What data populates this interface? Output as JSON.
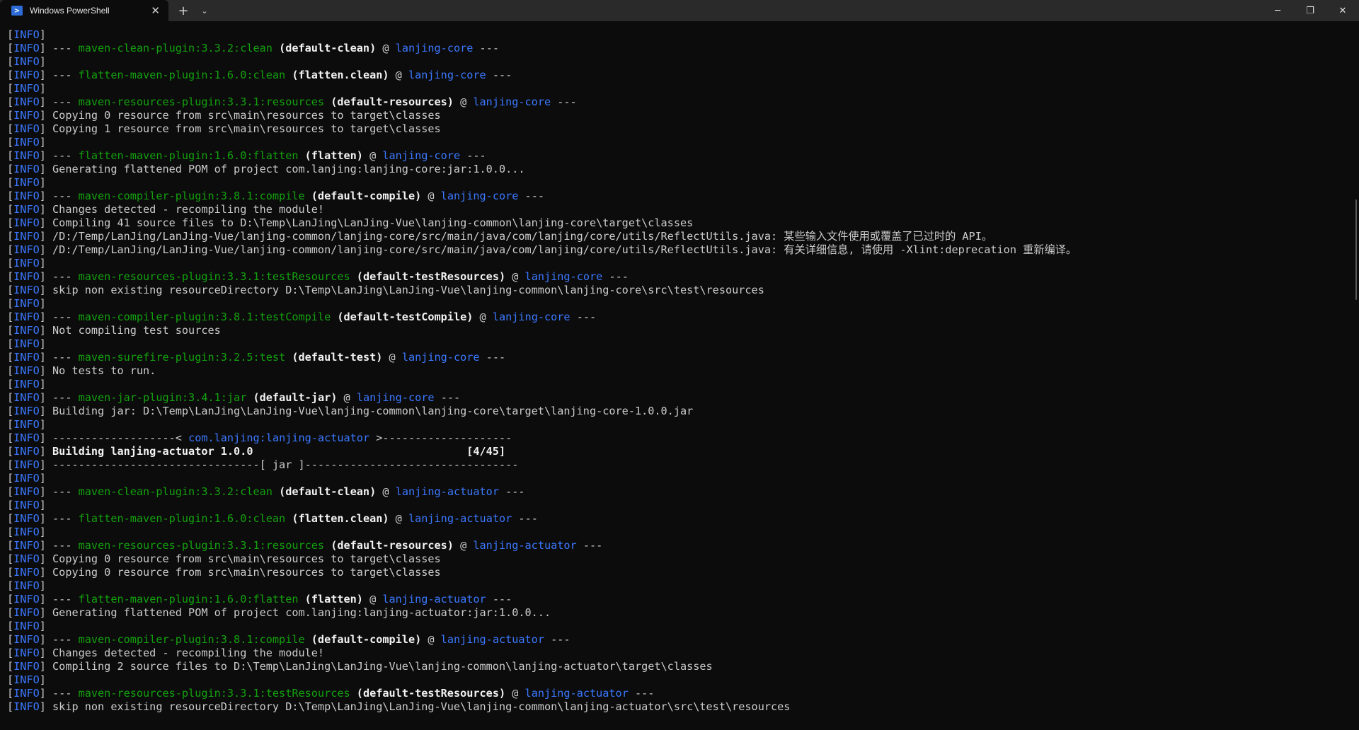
{
  "window": {
    "tab_title": "Windows PowerShell",
    "tab_icon": "powershell-icon",
    "close_glyph": "✕",
    "new_tab_glyph": "+",
    "dropdown_glyph": "⌄",
    "minimize_glyph": "─",
    "restore_glyph": "❐",
    "window_close_glyph": "✕"
  },
  "colors": {
    "background": "#0c0c0c",
    "info": "#3b78ff",
    "plugin": "#13a10e",
    "project": "#3b78ff",
    "text": "#cccccc"
  },
  "terminal": {
    "lines": [
      {
        "type": "blank",
        "level": "INFO"
      },
      {
        "type": "plugin",
        "level": "INFO",
        "prefix": "--- ",
        "plugin": "maven-clean-plugin:3.3.2:clean",
        "exec": " (default-clean)",
        "at": " @ ",
        "project": "lanjing-core",
        "suffix": " ---"
      },
      {
        "type": "blank",
        "level": "INFO"
      },
      {
        "type": "plugin",
        "level": "INFO",
        "prefix": "--- ",
        "plugin": "flatten-maven-plugin:1.6.0:clean",
        "exec": " (flatten.clean)",
        "at": " @ ",
        "project": "lanjing-core",
        "suffix": " ---"
      },
      {
        "type": "blank",
        "level": "INFO"
      },
      {
        "type": "plugin",
        "level": "INFO",
        "prefix": "--- ",
        "plugin": "maven-resources-plugin:3.3.1:resources",
        "exec": " (default-resources)",
        "at": " @ ",
        "project": "lanjing-core",
        "suffix": " ---"
      },
      {
        "type": "text",
        "level": "INFO",
        "text": "Copying 0 resource from src\\main\\resources to target\\classes"
      },
      {
        "type": "text",
        "level": "INFO",
        "text": "Copying 1 resource from src\\main\\resources to target\\classes"
      },
      {
        "type": "blank",
        "level": "INFO"
      },
      {
        "type": "plugin",
        "level": "INFO",
        "prefix": "--- ",
        "plugin": "flatten-maven-plugin:1.6.0:flatten",
        "exec": " (flatten)",
        "at": " @ ",
        "project": "lanjing-core",
        "suffix": " ---"
      },
      {
        "type": "text",
        "level": "INFO",
        "text": "Generating flattened POM of project com.lanjing:lanjing-core:jar:1.0.0..."
      },
      {
        "type": "blank",
        "level": "INFO"
      },
      {
        "type": "plugin",
        "level": "INFO",
        "prefix": "--- ",
        "plugin": "maven-compiler-plugin:3.8.1:compile",
        "exec": " (default-compile)",
        "at": " @ ",
        "project": "lanjing-core",
        "suffix": " ---"
      },
      {
        "type": "text",
        "level": "INFO",
        "text": "Changes detected - recompiling the module!"
      },
      {
        "type": "text",
        "level": "INFO",
        "text": "Compiling 41 source files to D:\\Temp\\LanJing\\LanJing-Vue\\lanjing-common\\lanjing-core\\target\\classes"
      },
      {
        "type": "text",
        "level": "INFO",
        "text": "/D:/Temp/LanJing/LanJing-Vue/lanjing-common/lanjing-core/src/main/java/com/lanjing/core/utils/ReflectUtils.java: 某些输入文件使用或覆盖了已过时的 API。"
      },
      {
        "type": "text",
        "level": "INFO",
        "text": "/D:/Temp/LanJing/LanJing-Vue/lanjing-common/lanjing-core/src/main/java/com/lanjing/core/utils/ReflectUtils.java: 有关详细信息, 请使用 -Xlint:deprecation 重新编译。"
      },
      {
        "type": "blank",
        "level": "INFO"
      },
      {
        "type": "plugin",
        "level": "INFO",
        "prefix": "--- ",
        "plugin": "maven-resources-plugin:3.3.1:testResources",
        "exec": " (default-testResources)",
        "at": " @ ",
        "project": "lanjing-core",
        "suffix": " ---"
      },
      {
        "type": "text",
        "level": "INFO",
        "text": "skip non existing resourceDirectory D:\\Temp\\LanJing\\LanJing-Vue\\lanjing-common\\lanjing-core\\src\\test\\resources"
      },
      {
        "type": "blank",
        "level": "INFO"
      },
      {
        "type": "plugin",
        "level": "INFO",
        "prefix": "--- ",
        "plugin": "maven-compiler-plugin:3.8.1:testCompile",
        "exec": " (default-testCompile)",
        "at": " @ ",
        "project": "lanjing-core",
        "suffix": " ---"
      },
      {
        "type": "text",
        "level": "INFO",
        "text": "Not compiling test sources"
      },
      {
        "type": "blank",
        "level": "INFO"
      },
      {
        "type": "plugin",
        "level": "INFO",
        "prefix": "--- ",
        "plugin": "maven-surefire-plugin:3.2.5:test",
        "exec": " (default-test)",
        "at": " @ ",
        "project": "lanjing-core",
        "suffix": " ---"
      },
      {
        "type": "text",
        "level": "INFO",
        "text": "No tests to run."
      },
      {
        "type": "blank",
        "level": "INFO"
      },
      {
        "type": "plugin",
        "level": "INFO",
        "prefix": "--- ",
        "plugin": "maven-jar-plugin:3.4.1:jar",
        "exec": " (default-jar)",
        "at": " @ ",
        "project": "lanjing-core",
        "suffix": " ---"
      },
      {
        "type": "text",
        "level": "INFO",
        "text": "Building jar: D:\\Temp\\LanJing\\LanJing-Vue\\lanjing-common\\lanjing-core\\target\\lanjing-core-1.0.0.jar"
      },
      {
        "type": "blank",
        "level": "INFO"
      },
      {
        "type": "header",
        "level": "INFO",
        "left": "-------------------< ",
        "artifact": "com.lanjing:lanjing-actuator",
        "right": " >--------------------"
      },
      {
        "type": "bold",
        "level": "INFO",
        "text": "Building lanjing-actuator 1.0.0                                 [4/45]"
      },
      {
        "type": "text",
        "level": "INFO",
        "text": "--------------------------------[ jar ]---------------------------------"
      },
      {
        "type": "blank",
        "level": "INFO"
      },
      {
        "type": "plugin",
        "level": "INFO",
        "prefix": "--- ",
        "plugin": "maven-clean-plugin:3.3.2:clean",
        "exec": " (default-clean)",
        "at": " @ ",
        "project": "lanjing-actuator",
        "suffix": " ---"
      },
      {
        "type": "blank",
        "level": "INFO"
      },
      {
        "type": "plugin",
        "level": "INFO",
        "prefix": "--- ",
        "plugin": "flatten-maven-plugin:1.6.0:clean",
        "exec": " (flatten.clean)",
        "at": " @ ",
        "project": "lanjing-actuator",
        "suffix": " ---"
      },
      {
        "type": "blank",
        "level": "INFO"
      },
      {
        "type": "plugin",
        "level": "INFO",
        "prefix": "--- ",
        "plugin": "maven-resources-plugin:3.3.1:resources",
        "exec": " (default-resources)",
        "at": " @ ",
        "project": "lanjing-actuator",
        "suffix": " ---"
      },
      {
        "type": "text",
        "level": "INFO",
        "text": "Copying 0 resource from src\\main\\resources to target\\classes"
      },
      {
        "type": "text",
        "level": "INFO",
        "text": "Copying 0 resource from src\\main\\resources to target\\classes"
      },
      {
        "type": "blank",
        "level": "INFO"
      },
      {
        "type": "plugin",
        "level": "INFO",
        "prefix": "--- ",
        "plugin": "flatten-maven-plugin:1.6.0:flatten",
        "exec": " (flatten)",
        "at": " @ ",
        "project": "lanjing-actuator",
        "suffix": " ---"
      },
      {
        "type": "text",
        "level": "INFO",
        "text": "Generating flattened POM of project com.lanjing:lanjing-actuator:jar:1.0.0..."
      },
      {
        "type": "blank",
        "level": "INFO"
      },
      {
        "type": "plugin",
        "level": "INFO",
        "prefix": "--- ",
        "plugin": "maven-compiler-plugin:3.8.1:compile",
        "exec": " (default-compile)",
        "at": " @ ",
        "project": "lanjing-actuator",
        "suffix": " ---"
      },
      {
        "type": "text",
        "level": "INFO",
        "text": "Changes detected - recompiling the module!"
      },
      {
        "type": "text",
        "level": "INFO",
        "text": "Compiling 2 source files to D:\\Temp\\LanJing\\LanJing-Vue\\lanjing-common\\lanjing-actuator\\target\\classes"
      },
      {
        "type": "blank",
        "level": "INFO"
      },
      {
        "type": "plugin",
        "level": "INFO",
        "prefix": "--- ",
        "plugin": "maven-resources-plugin:3.3.1:testResources",
        "exec": " (default-testResources)",
        "at": " @ ",
        "project": "lanjing-actuator",
        "suffix": " ---"
      },
      {
        "type": "text",
        "level": "INFO",
        "text": "skip non existing resourceDirectory D:\\Temp\\LanJing\\LanJing-Vue\\lanjing-common\\lanjing-actuator\\src\\test\\resources"
      }
    ]
  }
}
